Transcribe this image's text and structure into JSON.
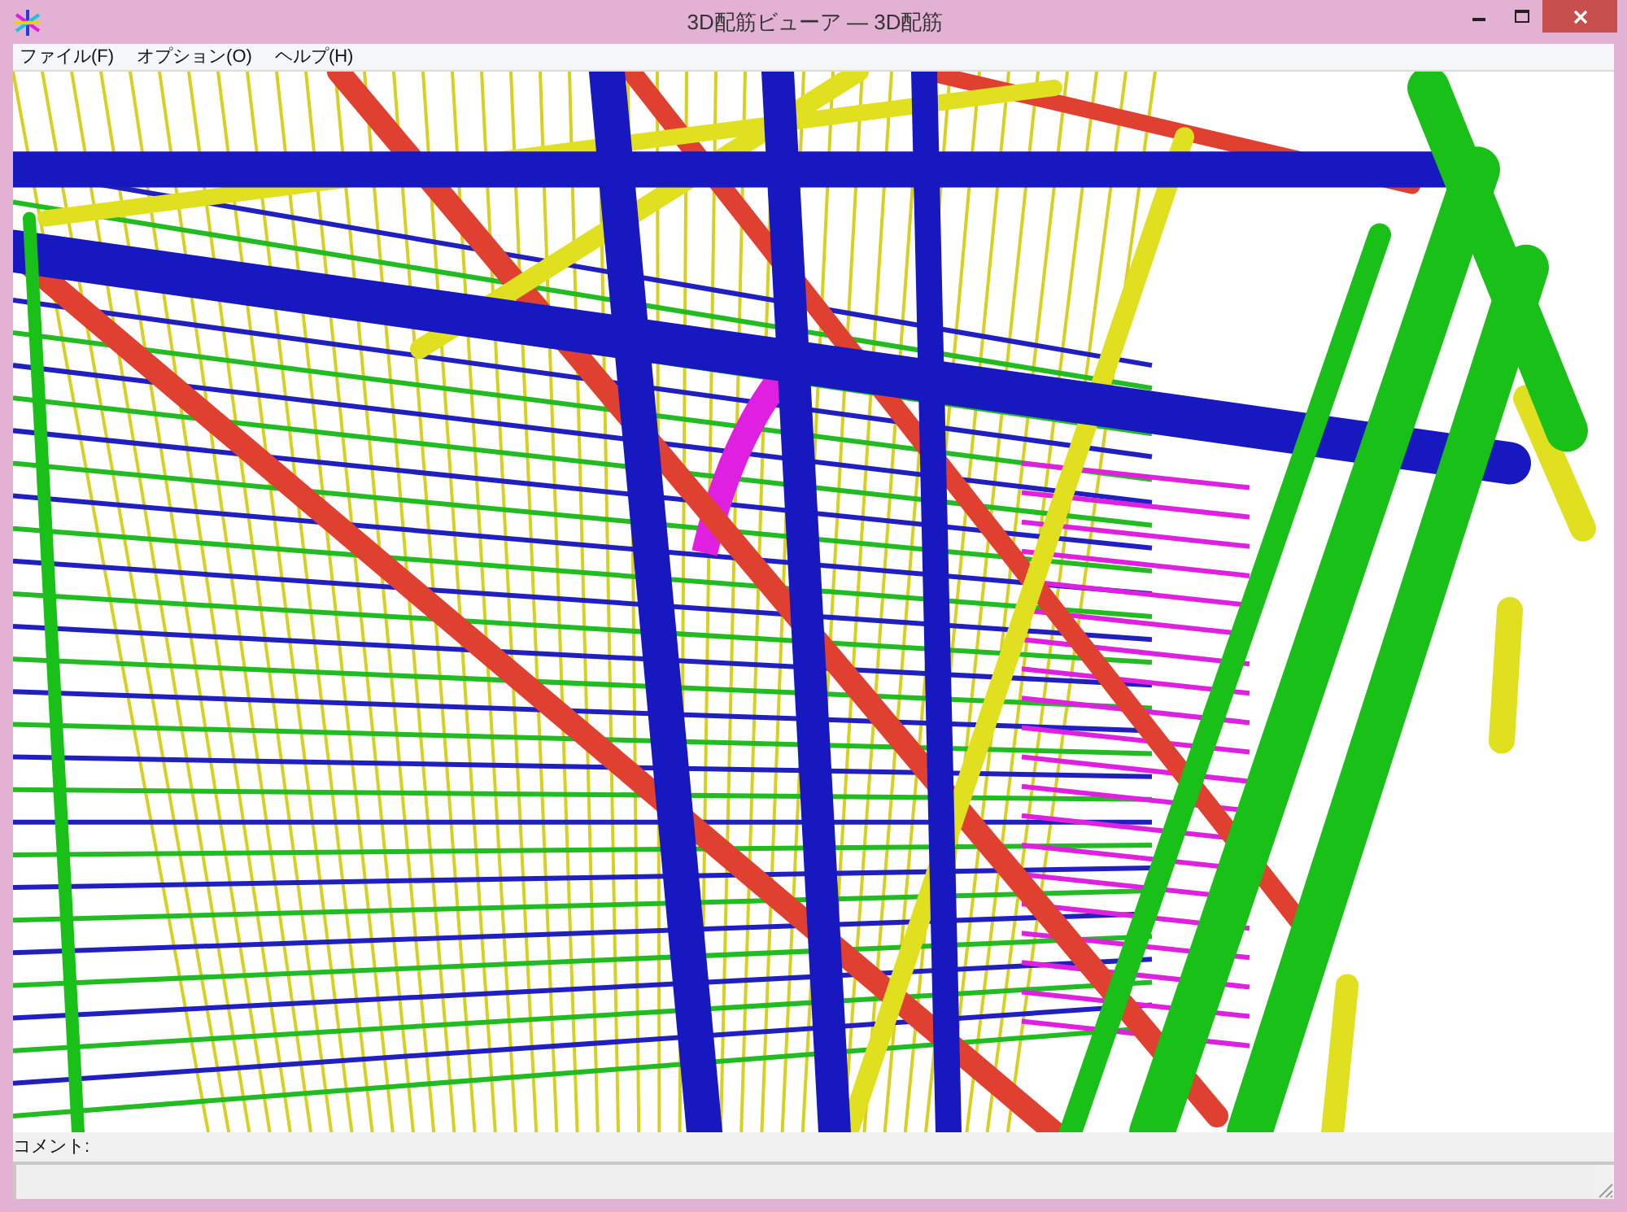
{
  "window": {
    "title": "3D配筋ビューア ― 3D配筋"
  },
  "menu": [
    "ファイル(F)",
    "オプション(O)",
    "ヘルプ(H)"
  ],
  "comment": {
    "label": "コメント:"
  }
}
